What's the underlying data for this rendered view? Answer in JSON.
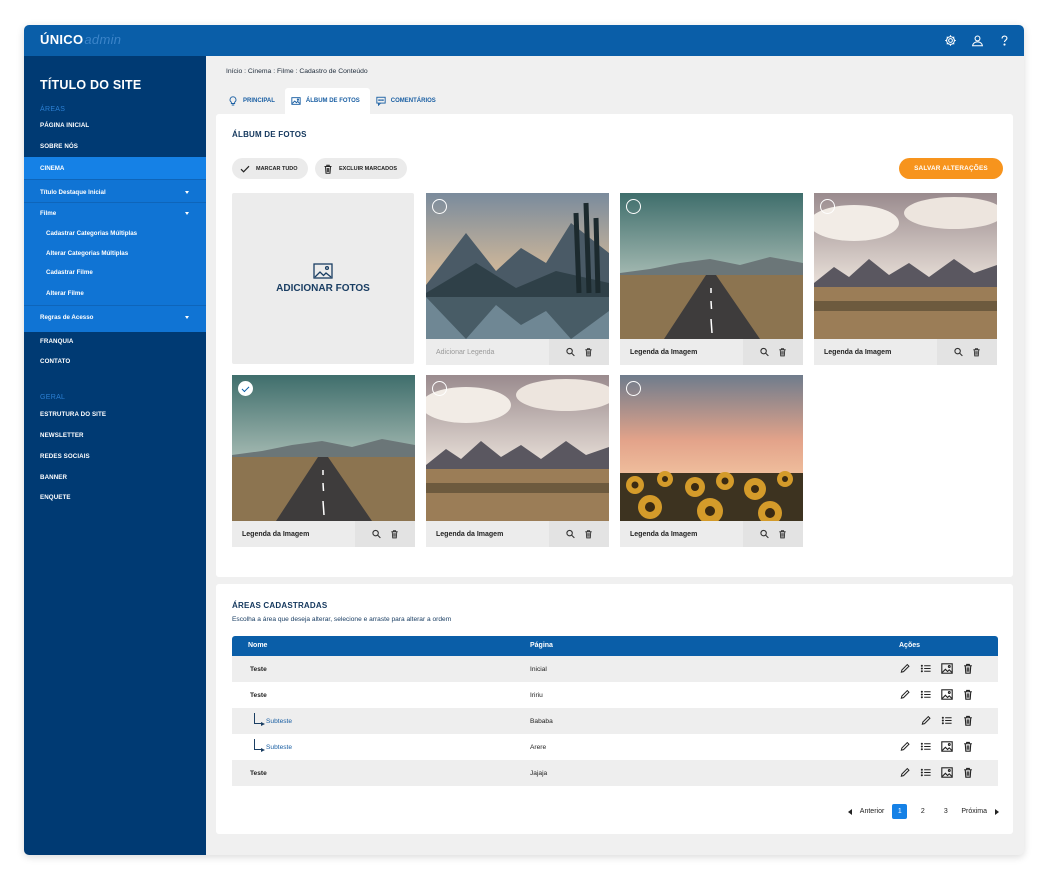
{
  "app": {
    "logo_main": "ÚNICO",
    "logo_sub": "admin"
  },
  "sidebar": {
    "site_title": "TÍTULO DO SITE",
    "section_areas": "ÁREAS",
    "section_geral": "GERAL",
    "items_top": [
      "PÁGINA INICIAL",
      "SOBRE NÓS"
    ],
    "cinema": "CINEMA",
    "cinema_sub": [
      "Título Destaque Inicial",
      "Filme",
      "Cadastrar Categorias Múltiplas",
      "Alterar Categorias Múltiplas",
      "Cadastrar Filme",
      "Alterar Filme",
      "Regras de Acesso"
    ],
    "items_mid": [
      "FRANQUIA",
      "CONTATO"
    ],
    "items_geral": [
      "ESTRUTURA DO SITE",
      "NEWSLETTER",
      "REDES SOCIAIS",
      "BANNER",
      "ENQUETE"
    ]
  },
  "breadcrumb": [
    "Início",
    "Cinema",
    "Filme",
    "Cadastro de Conteúdo"
  ],
  "breadcrumb_sep": ":",
  "tabs": [
    "PRINCIPAL",
    "ÁLBUM DE FOTOS",
    "COMENTÁRIOS"
  ],
  "album": {
    "title": "ÁLBUM DE FOTOS",
    "mark_all": "MARCAR TUDO",
    "delete_marked": "EXCLUIR MARCADOS",
    "save": "SALVAR ALTERAÇÕES",
    "add_photos": "ADICIONAR FOTOS",
    "photos": [
      {
        "caption": "Adicionar Legenda",
        "placeholder": true,
        "checked": false,
        "scene": "lake"
      },
      {
        "caption": "Legenda da Imagem",
        "placeholder": false,
        "checked": false,
        "scene": "road"
      },
      {
        "caption": "Legenda da Imagem",
        "placeholder": false,
        "checked": false,
        "scene": "mountains"
      },
      {
        "caption": "Legenda da Imagem",
        "placeholder": false,
        "checked": true,
        "scene": "road"
      },
      {
        "caption": "Legenda da Imagem",
        "placeholder": false,
        "checked": false,
        "scene": "mountains"
      },
      {
        "caption": "Legenda da Imagem",
        "placeholder": false,
        "checked": false,
        "scene": "sunflowers"
      }
    ]
  },
  "areas": {
    "title": "ÁREAS CADASTRADAS",
    "description": "Escolha a área que deseja alterar, selecione e arraste para alterar a ordem",
    "headers": {
      "name": "Nome",
      "page": "Página",
      "actions": "Ações"
    },
    "rows": [
      {
        "name": "Teste",
        "page": "Inicial",
        "sub": false,
        "image_action": true
      },
      {
        "name": "Teste",
        "page": "Iririu",
        "sub": false,
        "image_action": true
      },
      {
        "name": "Subteste",
        "page": "Bababa",
        "sub": true,
        "image_action": false
      },
      {
        "name": "Subteste",
        "page": "Arere",
        "sub": true,
        "image_action": true
      },
      {
        "name": "Teste",
        "page": "Jajaja",
        "sub": false,
        "image_action": true
      }
    ]
  },
  "pagination": {
    "prev": "Anterior",
    "next": "Próxima",
    "pages": [
      "1",
      "2",
      "3"
    ],
    "current": "1"
  },
  "colors": {
    "topbar": "#0a5ea8",
    "sidebar": "#003a73",
    "accent": "#1581e6",
    "save": "#f7941d"
  }
}
